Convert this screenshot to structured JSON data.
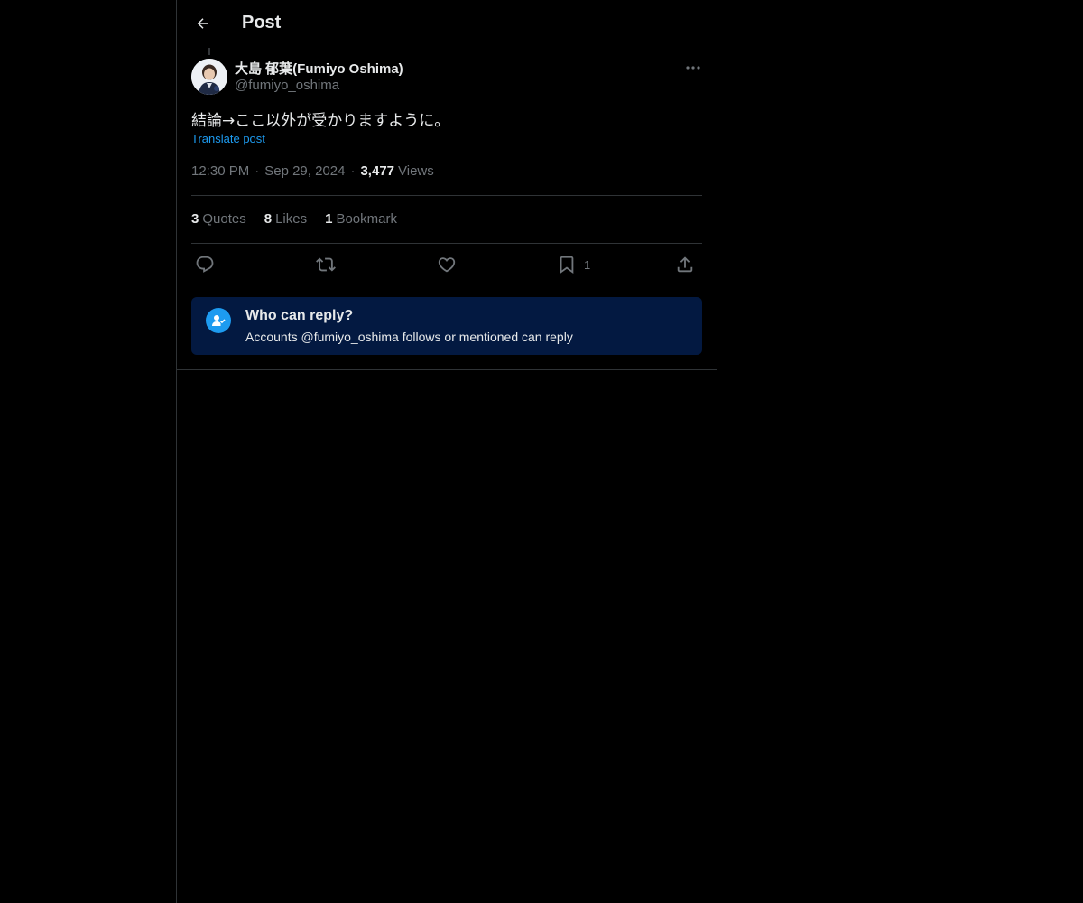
{
  "header": {
    "title": "Post",
    "back_icon": "arrow-left-icon"
  },
  "post": {
    "author": {
      "display_name": "大島 郁葉(Fumiyo Oshima)",
      "handle": "@fumiyo_oshima"
    },
    "text": "結論→ここ以外が受かりますように。",
    "translate_label": "Translate post",
    "time": "12:30 PM",
    "date": "Sep 29, 2024",
    "views_count": "3,477",
    "views_label": "Views",
    "separator": "·",
    "stats": {
      "quotes_count": "3",
      "quotes_label": "Quotes",
      "likes_count": "8",
      "likes_label": "Likes",
      "bookmarks_count": "1",
      "bookmarks_label": "Bookmark"
    },
    "actions": {
      "reply_icon": "reply-icon",
      "repost_icon": "repost-icon",
      "like_icon": "heart-icon",
      "bookmark_icon": "bookmark-icon",
      "bookmark_count": "1",
      "share_icon": "share-icon"
    }
  },
  "reply_restriction": {
    "title": "Who can reply?",
    "subtitle": "Accounts @fumiyo_oshima follows or mentioned can reply",
    "icon": "user-check-icon"
  },
  "colors": {
    "background": "#000000",
    "text_primary": "#e7e9ea",
    "text_secondary": "#71767b",
    "accent": "#1d9bf0",
    "divider": "#2f3336",
    "reply_box_bg": "#031941"
  }
}
